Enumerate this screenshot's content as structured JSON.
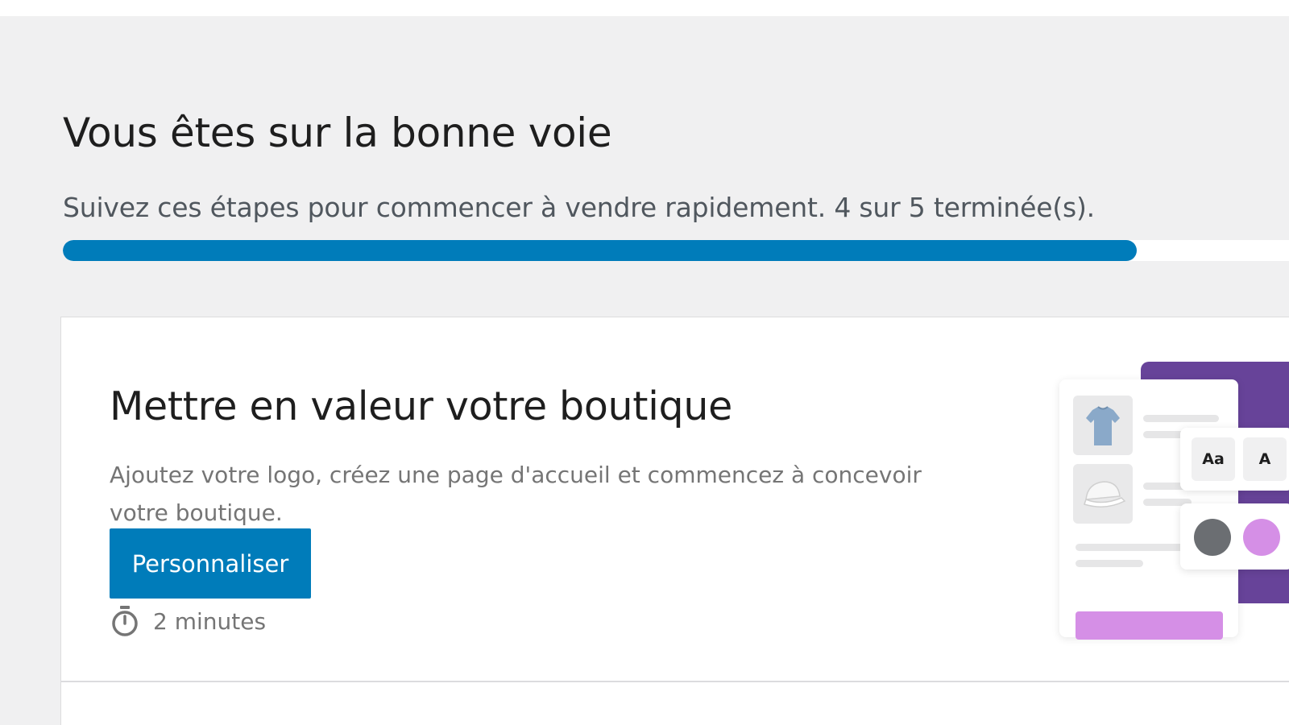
{
  "header": {
    "title": "Vous êtes sur la bonne voie",
    "subtitle": "Suivez ces étapes pour commencer à vendre rapidement. 4 sur 5 terminée(s).",
    "progress": {
      "completed": 4,
      "total": 5,
      "fraction": 0.8,
      "color": "#007cba"
    }
  },
  "task": {
    "title": "Mettre en valeur votre boutique",
    "description": "Ajoutez votre logo, créez une page d'accueil et commencez à concevoir votre boutique.",
    "button_label": "Personnaliser",
    "time_icon": "timer-icon",
    "time_estimate": "2 minutes",
    "illustration": {
      "font_chip_label": "Aa",
      "font_chip_label_2": "A",
      "accent_purple": "#674399",
      "accent_pink": "#d58fe6",
      "swatch_gray": "#6b6e72"
    }
  }
}
